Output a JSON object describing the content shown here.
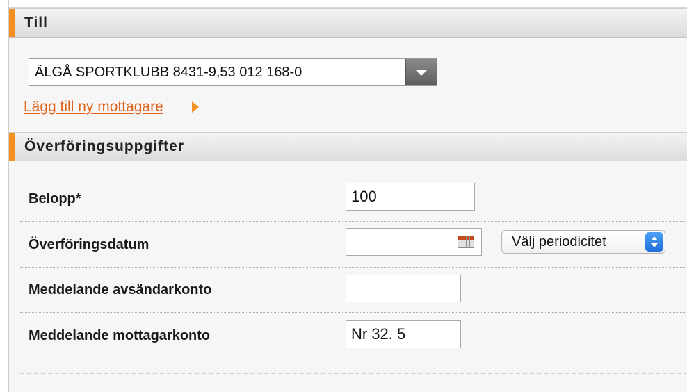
{
  "to_section": {
    "title": "Till",
    "recipient_select": {
      "value": "ÄLGÅ SPORTKLUBB 8431-9,53 012 168-0"
    },
    "add_recipient_link": "Lägg till ny mottagare"
  },
  "details_section": {
    "title": "Överföringsuppgifter",
    "fields": {
      "amount": {
        "label": "Belopp*",
        "value": "100"
      },
      "date": {
        "label": "Överföringsdatum",
        "value": "",
        "icon": "calendar-icon"
      },
      "periodicity": {
        "value": "Välj periodicitet"
      },
      "sender_message": {
        "label": "Meddelande avsändarkonto",
        "value": ""
      },
      "recipient_message": {
        "label": "Meddelande mottagarkonto",
        "value": "Nr 32. 5"
      }
    }
  },
  "colors": {
    "accent": "#f39021",
    "link": "#e2621b",
    "select_stepper": "#2f86e8"
  }
}
